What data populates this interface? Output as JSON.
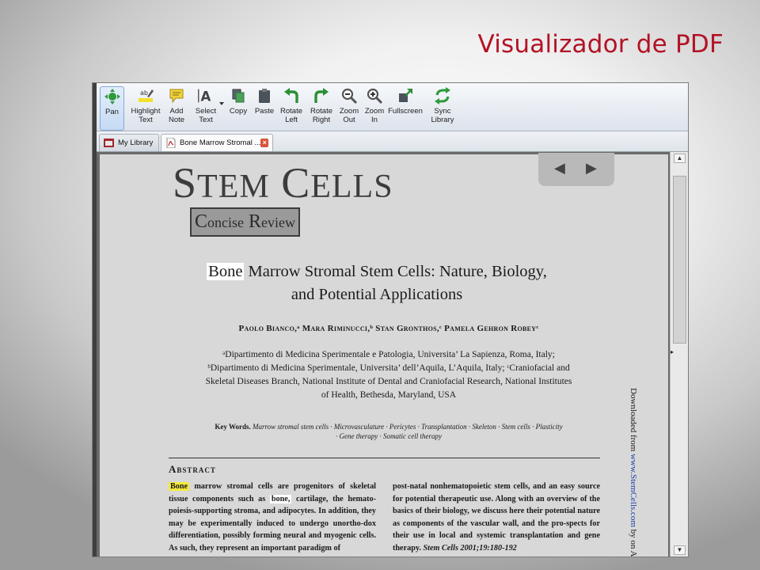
{
  "slide": {
    "title": "Visualizador de PDF"
  },
  "toolbar": {
    "buttons": [
      {
        "label": "Pan",
        "icon": "pan-icon"
      },
      {
        "label": "Highlight\nText",
        "icon": "highlight-icon"
      },
      {
        "label": "Add\nNote",
        "icon": "note-icon"
      },
      {
        "label": "Select\nText",
        "icon": "select-text-icon"
      },
      {
        "label": "Copy",
        "icon": "copy-icon"
      },
      {
        "label": "Paste",
        "icon": "paste-icon"
      },
      {
        "label": "Rotate\nLeft",
        "icon": "rotate-left-icon"
      },
      {
        "label": "Rotate\nRight",
        "icon": "rotate-right-icon"
      },
      {
        "label": "Zoom\nOut",
        "icon": "zoom-out-icon"
      },
      {
        "label": "Zoom\nIn",
        "icon": "zoom-in-icon"
      },
      {
        "label": "Fullscreen",
        "icon": "fullscreen-icon"
      },
      {
        "label": "Sync\nLibrary",
        "icon": "sync-icon"
      }
    ]
  },
  "tabs": [
    {
      "label": "My Library",
      "icon": "library-icon"
    },
    {
      "label": "Bone Marrow Stromal ...",
      "icon": "pdf-icon"
    }
  ],
  "document": {
    "journal_cap1": "S",
    "journal_rest1": "TEM",
    "journal_cap2": "C",
    "journal_rest2": "ELLS",
    "section_c": "C",
    "section_oncise": "oncise",
    "section_r": "R",
    "section_eview": "eview",
    "title_highlight": "Bone",
    "title_rest": " Marrow Stromal Stem Cells: Nature, Biology,",
    "title_line2": "and Potential Applications",
    "authors": "Paolo Bianco,ᵃ Mara Riminucci,ᵇ Stan Gronthos,ᶜ Pamela Gehron Robeyᶜ",
    "affil_1": "ᵃDipartimento di Medicina Sperimentale e Patologia, Universita’ La Sapienza, Roma, Italy;",
    "affil_2": "ᵇDipartimento di Medicina Sperimentale, Universita’ dell’Aquila, L’Aquila, Italy; ᶜCraniofacial and",
    "affil_3": "Skeletal Diseases Branch, National Institute of Dental and Craniofacial Research, National Institutes",
    "affil_4": "of Health, Bethesda, Maryland, USA",
    "keywords_label": "Key Words.",
    "keywords_1": " Marrow stromal stem cells · Microvasculature · Pericytes · Transplantation · Skeleton · Stem cells · Plasticity",
    "keywords_2": "· Gene therapy · Somatic cell therapy",
    "abstract_heading": "Abstract",
    "col1_hl": "Bone",
    "col1_a": " marrow stromal cells are progenitors of skeletal tissue components such as ",
    "col1_hl2": "bone,",
    "col1_b": " cartilage, the hemato-poiesis-supporting stroma, and adipocytes. In addition, they may be experimentally induced to undergo unortho-dox differentiation, possibly forming neural and myogenic cells. As such, they represent an important paradigm of",
    "col2_a": "post-natal nonhematopoietic stem cells, and an easy source for potential therapeutic use. Along with an overview of the basics of their biology, we discuss here their potential nature as components of the vascular wall, and the pro-spects for their use in local and systemic transplantation and gene therapy. ",
    "col2_cite": "Stem Cells 2001;19:180-192",
    "side_pre": "Downloaded from ",
    "side_link": "www.StemCells.com",
    "side_post": " by on A"
  },
  "colors": {
    "title_red": "#b31225",
    "highlight_yellow": "#f5ea3e",
    "link_blue": "#1a3ea8"
  }
}
